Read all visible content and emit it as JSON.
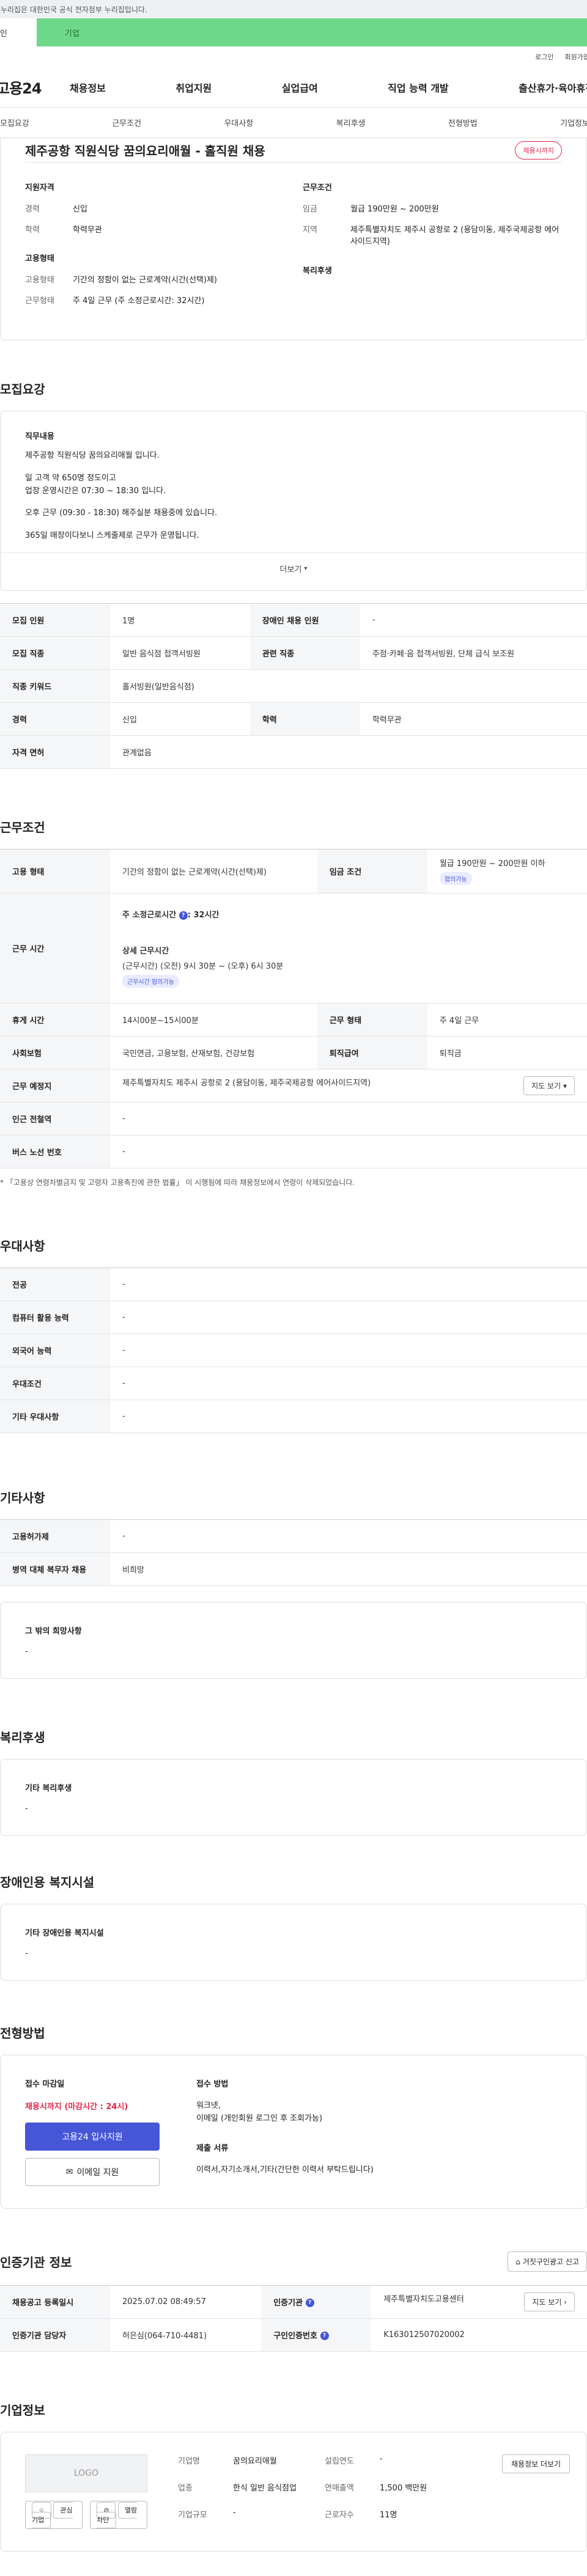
{
  "banner": {
    "text": "이 누리집은 대한민국 공식 전자정부 누리집입니다."
  },
  "member_tabs": {
    "personal": "개인",
    "company": "기업"
  },
  "util": {
    "login": "로그인",
    "join": "회원가입"
  },
  "gnb": {
    "logo": "고용24",
    "menu": [
      "채용정보",
      "취업지원",
      "실업급여",
      "직업 능력 개발",
      "출산휴가·육아휴직"
    ]
  },
  "anchor_nav": [
    "모집요강",
    "근무조건",
    "우대사항",
    "복리후생",
    "전형방법",
    "기업정보"
  ],
  "job": {
    "title": "제주공항 직원식당 꿈의요리애월 - 홀직원 채용",
    "deadline_badge": "채용시까지",
    "qualification_title": "지원자격",
    "career_label": "경력",
    "career_value": "신입",
    "education_label": "학력",
    "education_value": "학력무관",
    "emp_type_title": "고용형태",
    "emp_type_label": "고용형태",
    "emp_type_value": "기간의 정함이 없는 근로계약(시간(선택)제)",
    "work_type_label": "근무형태",
    "work_type_value": "주 4일 근무 (주 소정근로시간: 32시간)",
    "conditions_title": "근무조건",
    "wage_label": "임금",
    "wage_value": "월급 190만원 ~ 200만원",
    "region_label": "지역",
    "region_value": "제주특별자치도 제주시 공항로 2 (용담이동, 제주국제공항 에어사이드지역)",
    "welfare_title": "복리후생"
  },
  "recruit": {
    "section_title": "모집요강",
    "duty_title": "직무내용",
    "duty_lines": [
      "제주공항 직원식당 꿈의요리애월 입니다.",
      "일 고객 약 650명 정도이고\n업장 운영시간은 07:30 ~ 18:30 입니다.",
      "오후 근무 (09:30 - 18:30) 해주실분 채용중에 있습니다.",
      "365일 매장이다보니 스케줄제로 근무가 운영됩니다."
    ],
    "more": "더보기",
    "rows": [
      [
        "모집 인원",
        "1명",
        "장애인 채용 인원",
        "-"
      ],
      [
        "모집 직종",
        "일반 음식점 접객서빙원",
        "관련 직종",
        "주점·카페·음 접객서빙원, 단체 급식 보조원"
      ],
      [
        "직종 키워드",
        "홀서빙원(일반음식점)",
        "",
        ""
      ],
      [
        "경력",
        "신입",
        "학력",
        "학력무관"
      ],
      [
        "자격 면허",
        "관계없음",
        "",
        ""
      ]
    ]
  },
  "work": {
    "section_title": "근무조건",
    "emp_type_label": "고용 형태",
    "emp_type_value": "기간의 정함이 없는 근로계약(시간(선택)제)",
    "wage_label": "임금 조건",
    "wage_value": "월급 190만원 ~ 200만원 이하",
    "wage_pill": "협의가능",
    "hours_label": "근무 시간",
    "hours_week": "주 소정근로시간",
    "hours_week_value": ": 32시간",
    "hours_detail_title": "상세 근무시간",
    "hours_detail": "(근무시간) (오전) 9시 30분 ~ (오후) 6시 30분",
    "hours_pill": "근무시간 협의가능",
    "rows": [
      [
        "휴게 시간",
        "14시00분~15시00분",
        "근무 형태",
        "주 4일 근무"
      ],
      [
        "사회보험",
        "국민연금, 고용보험, 산재보험, 건강보험",
        "퇴직급여",
        "퇴직금"
      ],
      [
        "근무 예정지",
        "제주특별자치도 제주시 공항로 2 (용담이동, 제주국제공항 에어사이드지역)",
        "",
        ""
      ],
      [
        "인근 전철역",
        "-",
        "",
        ""
      ],
      [
        "버스 노선 번호",
        "-",
        "",
        ""
      ]
    ],
    "map_btn": "지도 보기",
    "note": "* 「고용상 연령차별금지 및 고령자 고용촉진에 관한 법률」 이 시행됨에 따라 채용정보에서 연령이 삭제되었습니다."
  },
  "preference": {
    "section_title": "우대사항",
    "rows": [
      [
        "전공",
        "-"
      ],
      [
        "컴퓨터 활용 능력",
        "-"
      ],
      [
        "외국어 능력",
        "-"
      ],
      [
        "우대조건",
        "-"
      ],
      [
        "기타 우대사항",
        "-"
      ]
    ]
  },
  "etc": {
    "section_title": "기타사항",
    "rows": [
      [
        "고용허가제",
        "-"
      ],
      [
        "병역 대체 복무자 채용",
        "비희망"
      ]
    ],
    "box_title": "그 밖의 희망사항",
    "box_value": "-"
  },
  "welfare": {
    "section_title": "복리후생",
    "box_title": "기타 복리후생",
    "box_value": "-"
  },
  "disabled": {
    "section_title": "장애인용 복지시설",
    "box_title": "기타 장애인용 복지시설",
    "box_value": "-"
  },
  "selection": {
    "section_title": "전형방법",
    "deadline_title": "접수 마감일",
    "deadline_value": "채용시까지 (마감시간 : 24시)",
    "apply_btn": "고용24 입사지원",
    "email_btn": "이메일 지원",
    "method_title": "접수 방법",
    "method_value": "워크넷,\n이메일 (개인회원 로그인 후 조회가능)",
    "docs_title": "제출 서류",
    "docs_value": "이력서,자기소개서,기타(간단한 이력서 부탁드립니다)"
  },
  "cert": {
    "section_title": "인증기관 정보",
    "report_btn": "거짓구인광고 신고",
    "rows": [
      [
        "채용공고 등록일시",
        "2025.07.02 08:49:57",
        "인증기관",
        "제주특별자치도고용센터"
      ],
      [
        "인증기관 담당자",
        "허은심(064-710-4481)",
        "구인인증번호",
        "K163012507020002"
      ]
    ],
    "map_btn": "지도 보기"
  },
  "company": {
    "section_title": "기업정보",
    "logo": "LOGO",
    "interest_btn": "관심기업",
    "block_btn": "열람차단",
    "name_label": "기업명",
    "name_value": "꿈의요리애월",
    "industry_label": "업종",
    "industry_value": "한식 일반 음식점업",
    "size_label": "기업규모",
    "size_value": "-",
    "founded_label": "설립연도",
    "founded_value": "-",
    "sales_label": "연매출액",
    "sales_value": "1,500 백만원",
    "employees_label": "근로자수",
    "employees_value": "11명",
    "jobs_btn": "채용정보 더보기"
  },
  "colors": {
    "accent": "#4656d6",
    "deadline_red": "#e2264a",
    "company_tab": "#6ed88a"
  }
}
